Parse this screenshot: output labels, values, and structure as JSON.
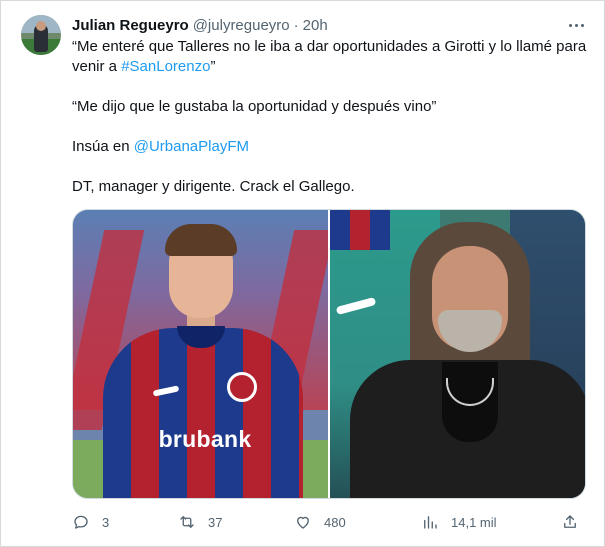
{
  "author": {
    "name": "Julian Regueyro",
    "handle": "@julyregueyro",
    "separator": "·",
    "time": "20h"
  },
  "tweet": {
    "line1_pre": "“Me enteré que Talleres no le iba a dar oportunidades a Girotti y lo llamé para venir a ",
    "line1_hashtag": "#SanLorenzo",
    "line1_post": "”",
    "line2": "“Me dijo que le gustaba la oportunidad y después vino”",
    "line3_pre": "Insúa en ",
    "line3_mention": "@UrbanaPlayFM",
    "line4": "DT, manager y dirigente. Crack el Gallego."
  },
  "media": {
    "sponsor_text": "brubank"
  },
  "actions": {
    "replies": "3",
    "reposts": "37",
    "likes": "480",
    "views": "14,1 mil"
  },
  "colors": {
    "link": "#1d9bf0",
    "secondary_text": "#536471",
    "primary_text": "#0f1419"
  },
  "icons": [
    "more-icon",
    "reply-icon",
    "repost-icon",
    "like-icon",
    "views-icon",
    "share-icon"
  ]
}
